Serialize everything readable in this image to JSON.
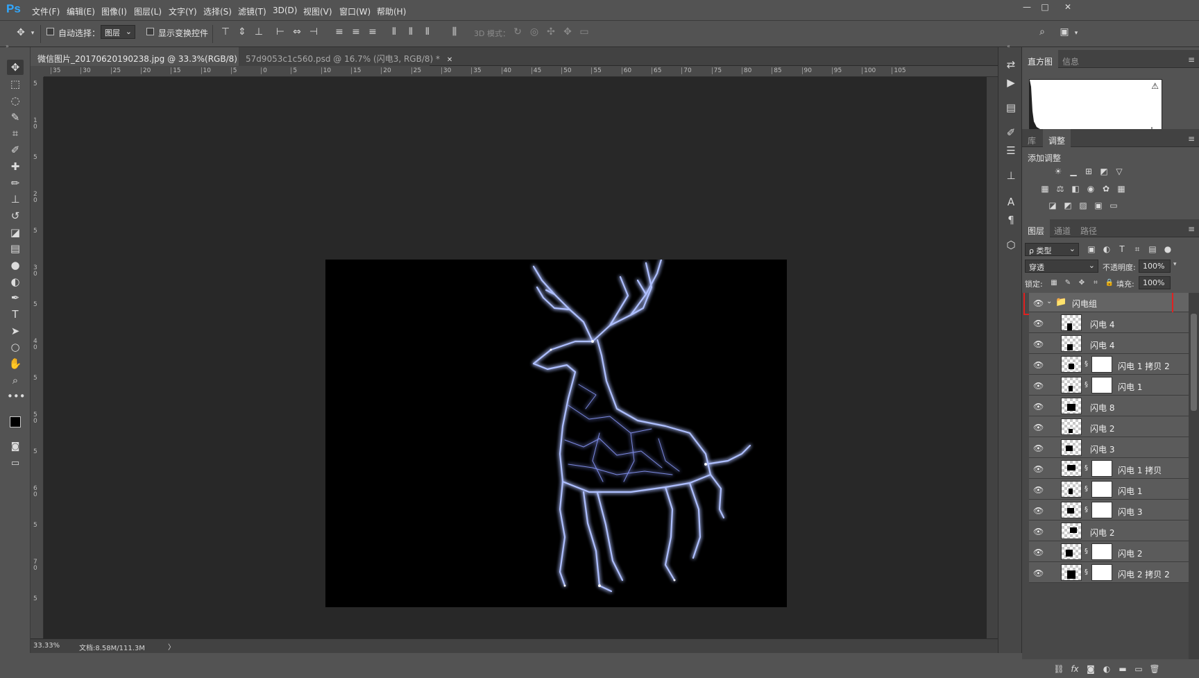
{
  "app": {
    "logo": "Ps"
  },
  "menu": [
    "文件(F)",
    "编辑(E)",
    "图像(I)",
    "图层(L)",
    "文字(Y)",
    "选择(S)",
    "滤镜(T)",
    "3D(D)",
    "视图(V)",
    "窗口(W)",
    "帮助(H)"
  ],
  "window_controls": {
    "minimize": "—",
    "restore": "□",
    "close": "✕"
  },
  "options": {
    "auto_select_label": "自动选择：",
    "auto_select_target": "图层",
    "show_transform_label": "显示变换控件",
    "mode_3d_label": "3D 模式："
  },
  "tabs": [
    {
      "label": "微信图片_20170620190238.jpg @ 33.3%(RGB/8) *",
      "close": "✕",
      "active": true
    },
    {
      "label": "57d9053c1c560.psd @ 16.7% (闪电3, RGB/8) *",
      "close": "✕",
      "active": false
    }
  ],
  "ruler": {
    "h_ticks": [
      "35",
      "30",
      "25",
      "20",
      "15",
      "10",
      "5",
      "0",
      "5",
      "10",
      "15",
      "20",
      "25",
      "30",
      "35",
      "40",
      "45",
      "50",
      "55",
      "60",
      "65",
      "70",
      "75",
      "80",
      "85",
      "90",
      "95",
      "100",
      "105"
    ],
    "v_ticks": [
      "5",
      "1 0",
      "5",
      "2 0",
      "5",
      "3 0",
      "5",
      "4 0",
      "5",
      "5 0",
      "5",
      "6 0",
      "5",
      "7 0",
      "5"
    ]
  },
  "status": {
    "zoom": "33.33%",
    "doc": "文档:8.58M/111.3M",
    "arrow": "〉"
  },
  "panels": {
    "histogram": {
      "tabs": [
        "直方图",
        "信息"
      ],
      "warning": "⚠"
    },
    "adjust": {
      "tabs": [
        "库",
        "调整"
      ],
      "title": "添加调整"
    },
    "layers": {
      "tabs": [
        "图层",
        "通道",
        "路径"
      ],
      "filter_label": "ρ 类型",
      "blend_mode": "穿透",
      "opacity_label": "不透明度:",
      "opacity_value": "100%",
      "lock_label": "锁定:",
      "fill_label": "填充:",
      "fill_value": "100%",
      "group_name": "闪电组",
      "items": [
        {
          "name": "闪电 4",
          "mask": false
        },
        {
          "name": "闪电 4",
          "mask": false
        },
        {
          "name": "闪电 1 拷贝 2",
          "mask": true
        },
        {
          "name": "闪电 1",
          "mask": true
        },
        {
          "name": "闪电 8",
          "mask": false
        },
        {
          "name": "闪电 2",
          "mask": false
        },
        {
          "name": "闪电 3",
          "mask": false
        },
        {
          "name": "闪电 1 拷贝",
          "mask": true
        },
        {
          "name": "闪电 1",
          "mask": true
        },
        {
          "name": "闪电 3",
          "mask": true
        },
        {
          "name": "闪电 2",
          "mask": false
        },
        {
          "name": "闪电 2",
          "mask": true
        },
        {
          "name": "闪电 2 拷贝 2",
          "mask": true
        }
      ]
    }
  },
  "colors": {
    "accent": "#31a8ff",
    "highlight_box": "#e02020",
    "lightning": "#aebfff"
  }
}
